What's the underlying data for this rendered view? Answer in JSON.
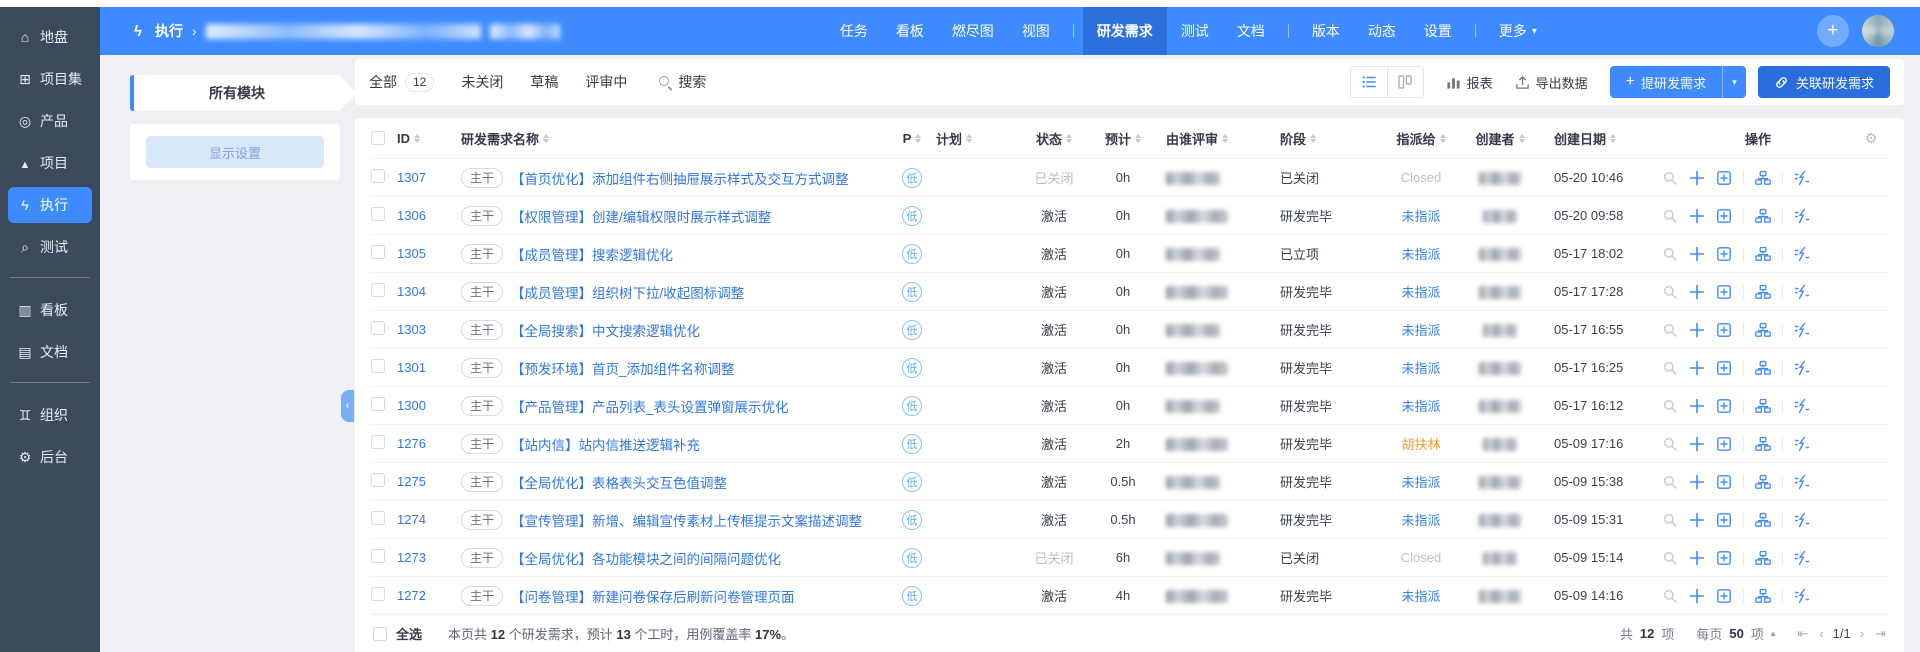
{
  "colors": {
    "accent": "#3e8bff",
    "accent_dark": "#2a6edd",
    "nav_active": "#2c70dd",
    "sidebar_bg": "#3d4a5e",
    "link": "#3077e3",
    "muted": "#b9bec7",
    "orange": "#f59a23",
    "page_bg": "#eef0f4"
  },
  "icons": {
    "plus": "+",
    "caret_down": "▾",
    "caret_up": "▴",
    "chevron_left": "‹",
    "breadcrumb_sep": "›",
    "page_first": "⇤",
    "page_prev": "‹",
    "page_next": "›",
    "page_last": "⇥",
    "gear": "⚙"
  },
  "sidebar": {
    "items": [
      {
        "label": "地盘",
        "icon": "home",
        "icon_name": "home-icon"
      },
      {
        "label": "项目集",
        "icon": "grid",
        "icon_name": "project-set-icon"
      },
      {
        "label": "产品",
        "icon": "product",
        "icon_name": "product-icon"
      },
      {
        "label": "项目",
        "icon": "rocket",
        "icon_name": "rocket-icon"
      },
      {
        "label": "执行",
        "icon": "run",
        "icon_name": "run-icon",
        "state": "active"
      },
      {
        "label": "测试",
        "icon": "magnifier",
        "icon_name": "magnifier-icon",
        "divider_after": true
      },
      {
        "label": "看板",
        "icon": "kanban",
        "icon_name": "kanban-icon"
      },
      {
        "label": "文档",
        "icon": "doc",
        "icon_name": "document-icon",
        "divider_after": true
      },
      {
        "label": "组织",
        "icon": "people",
        "icon_name": "people-icon"
      },
      {
        "label": "后台",
        "icon": "gear",
        "icon_name": "gear-icon"
      }
    ]
  },
  "topbar": {
    "app_label": "执行",
    "menu": [
      {
        "label": "任务"
      },
      {
        "label": "看板"
      },
      {
        "label": "燃尽图"
      },
      {
        "label": "视图",
        "divider_after": true
      },
      {
        "label": "研发需求",
        "state": "active"
      },
      {
        "label": "测试"
      },
      {
        "label": "文档",
        "divider_after": true
      },
      {
        "label": "版本"
      },
      {
        "label": "动态"
      },
      {
        "label": "设置",
        "divider_after": true
      },
      {
        "label": "更多",
        "dropdown": true
      }
    ]
  },
  "module_panel": {
    "all_modules": "所有模块",
    "display_settings": "显示设置"
  },
  "toolbar": {
    "tabs": [
      {
        "label": "全部",
        "count": "12",
        "state": "active"
      },
      {
        "label": "未关闭"
      },
      {
        "label": "草稿"
      },
      {
        "label": "评审中"
      }
    ],
    "search_label": "搜索",
    "report_label": "报表",
    "export_label": "导出数据",
    "create_label": "提研发需求",
    "link_label": "关联研发需求"
  },
  "table": {
    "columns": {
      "id": "ID",
      "name": "研发需求名称",
      "p": "P",
      "plan": "计划",
      "status": "状态",
      "estimate": "预计",
      "reviewer": "由谁评审",
      "stage": "阶段",
      "assignee": "指派给",
      "creator": "创建者",
      "created": "创建日期",
      "actions": "操作"
    },
    "rows": [
      {
        "id": "1307",
        "tag": "主干",
        "title": "【首页优化】添加组件右侧抽屉展示样式及交互方式调整",
        "priority": "低",
        "status": "已关闭",
        "status_state": "closed",
        "estimate": "0h",
        "stage": "已关闭",
        "assignee": "Closed",
        "assignee_state": "closed",
        "date": "05-20 10:46",
        "row_state": "closed"
      },
      {
        "id": "1306",
        "tag": "主干",
        "title": "【权限管理】创建/编辑权限时展示样式调整",
        "priority": "低",
        "status": "激活",
        "status_state": "active",
        "estimate": "0h",
        "stage": "研发完毕",
        "assignee": "未指派",
        "assignee_state": "unassigned",
        "date": "05-20 09:58"
      },
      {
        "id": "1305",
        "tag": "主干",
        "title": "【成员管理】搜索逻辑优化",
        "priority": "低",
        "status": "激活",
        "status_state": "active",
        "estimate": "0h",
        "stage": "已立项",
        "assignee": "未指派",
        "assignee_state": "unassigned",
        "date": "05-17 18:02"
      },
      {
        "id": "1304",
        "tag": "主干",
        "title": "【成员管理】组织树下拉/收起图标调整",
        "priority": "低",
        "status": "激活",
        "status_state": "active",
        "estimate": "0h",
        "stage": "研发完毕",
        "assignee": "未指派",
        "assignee_state": "unassigned",
        "date": "05-17 17:28"
      },
      {
        "id": "1303",
        "tag": "主干",
        "title": "【全局搜索】中文搜索逻辑优化",
        "priority": "低",
        "status": "激活",
        "status_state": "active",
        "estimate": "0h",
        "stage": "研发完毕",
        "assignee": "未指派",
        "assignee_state": "unassigned",
        "date": "05-17 16:55"
      },
      {
        "id": "1301",
        "tag": "主干",
        "title": "【预发环境】首页_添加组件名称调整",
        "priority": "低",
        "status": "激活",
        "status_state": "active",
        "estimate": "0h",
        "stage": "研发完毕",
        "assignee": "未指派",
        "assignee_state": "unassigned",
        "date": "05-17 16:25"
      },
      {
        "id": "1300",
        "tag": "主干",
        "title": "【产品管理】产品列表_表头设置弹窗展示优化",
        "priority": "低",
        "status": "激活",
        "status_state": "active",
        "estimate": "0h",
        "stage": "研发完毕",
        "assignee": "未指派",
        "assignee_state": "unassigned",
        "date": "05-17 16:12"
      },
      {
        "id": "1276",
        "tag": "主干",
        "title": "【站内信】站内信推送逻辑补充",
        "priority": "低",
        "status": "激活",
        "status_state": "active",
        "estimate": "2h",
        "stage": "研发完毕",
        "assignee": "胡扶林",
        "assignee_state": "user",
        "date": "05-09 17:16"
      },
      {
        "id": "1275",
        "tag": "主干",
        "title": "【全局优化】表格表头交互色值调整",
        "priority": "低",
        "status": "激活",
        "status_state": "active",
        "estimate": "0.5h",
        "stage": "研发完毕",
        "assignee": "未指派",
        "assignee_state": "unassigned",
        "date": "05-09 15:38"
      },
      {
        "id": "1274",
        "tag": "主干",
        "title": "【宣传管理】新增、编辑宣传素材上传框提示文案描述调整",
        "priority": "低",
        "status": "激活",
        "status_state": "active",
        "estimate": "0.5h",
        "stage": "研发完毕",
        "assignee": "未指派",
        "assignee_state": "unassigned",
        "date": "05-09 15:31"
      },
      {
        "id": "1273",
        "tag": "主干",
        "title": "【全局优化】各功能模块之间的间隔问题优化",
        "priority": "低",
        "status": "已关闭",
        "status_state": "closed",
        "estimate": "6h",
        "stage": "已关闭",
        "assignee": "Closed",
        "assignee_state": "closed",
        "date": "05-09 15:14",
        "row_state": "closed"
      },
      {
        "id": "1272",
        "tag": "主干",
        "title": "【问卷管理】新建问卷保存后刷新问卷管理页面",
        "priority": "低",
        "status": "激活",
        "status_state": "active",
        "estimate": "4h",
        "stage": "研发完毕",
        "assignee": "未指派",
        "assignee_state": "unassigned",
        "date": "05-09 14:16"
      }
    ]
  },
  "footer": {
    "select_all": "全选",
    "summary": {
      "p1": "本页共 ",
      "n1": "12",
      "p2": " 个研发需求，预计 ",
      "n2": "13",
      "p3": " 个工时，用例覆盖率 ",
      "n3": "17%",
      "p4": "。"
    },
    "pagination": {
      "total_prefix": "共",
      "total_count": "12",
      "total_suffix": "项",
      "per_prefix": "每页",
      "per_count": "50",
      "per_suffix": "项",
      "page": "1/1"
    }
  }
}
